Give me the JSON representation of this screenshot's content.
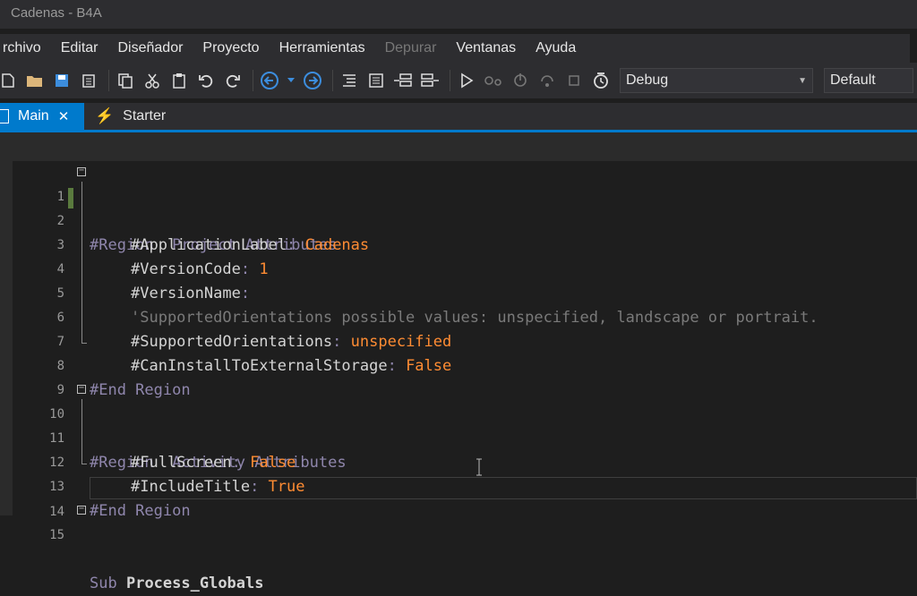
{
  "window": {
    "title": "Cadenas - B4A"
  },
  "menu": [
    {
      "label": "rchivo",
      "enabled": true
    },
    {
      "label": "Editar",
      "enabled": true
    },
    {
      "label": "Diseñador",
      "enabled": true
    },
    {
      "label": "Proyecto",
      "enabled": true
    },
    {
      "label": "Herramientas",
      "enabled": true
    },
    {
      "label": "Depurar",
      "enabled": false
    },
    {
      "label": "Ventanas",
      "enabled": true
    },
    {
      "label": "Ayuda",
      "enabled": true
    }
  ],
  "toolbar": {
    "icons": [
      "new-file-icon",
      "open-folder-icon",
      "save-icon",
      "save-all-icon",
      "copy-icon",
      "cut-icon",
      "paste-icon",
      "undo-icon",
      "redo-icon",
      "navigate-back-icon",
      "dropdown-arrow-icon",
      "navigate-forward-icon",
      "comment-icon",
      "uncomment-icon",
      "outdent-icon",
      "indent-icon",
      "run-icon",
      "step-icon",
      "step-into-icon",
      "step-over-icon",
      "stop-icon",
      "restart-icon"
    ],
    "build_mode": "Debug",
    "configuration": "Default"
  },
  "tabs": [
    {
      "label": "Main",
      "active": true
    },
    {
      "label": "Starter",
      "active": false
    }
  ],
  "code": {
    "lines": [
      {
        "num": "1",
        "text": "#Region  Project Attributes"
      },
      {
        "num": "2",
        "prop": "#ApplicationLabel",
        "value": "Cadenas"
      },
      {
        "num": "3",
        "prop": "#VersionCode",
        "value": "1"
      },
      {
        "num": "4",
        "prop": "#VersionName",
        "value": ""
      },
      {
        "num": "5",
        "comment": "'SupportedOrientations possible values: unspecified, landscape or portrait."
      },
      {
        "num": "6",
        "prop": "#SupportedOrientations",
        "value": "unspecified"
      },
      {
        "num": "7",
        "prop": "#CanInstallToExternalStorage",
        "value": "False"
      },
      {
        "num": "8",
        "text": "#End Region"
      },
      {
        "num": "9"
      },
      {
        "num": "10",
        "text": "#Region  Activity Attributes"
      },
      {
        "num": "11",
        "prop": "#FullScreen",
        "value": "False"
      },
      {
        "num": "12",
        "prop": "#IncludeTitle",
        "value": "True"
      },
      {
        "num": "13",
        "text": "#End Region"
      },
      {
        "num": "14"
      },
      {
        "num": "15",
        "kw": "Sub",
        "name": "Process_Globals"
      }
    ]
  },
  "colors": {
    "accent": "#007acc",
    "keyword": "#8f86ac",
    "value": "#ff8c33",
    "comment": "#7a7a7a"
  }
}
